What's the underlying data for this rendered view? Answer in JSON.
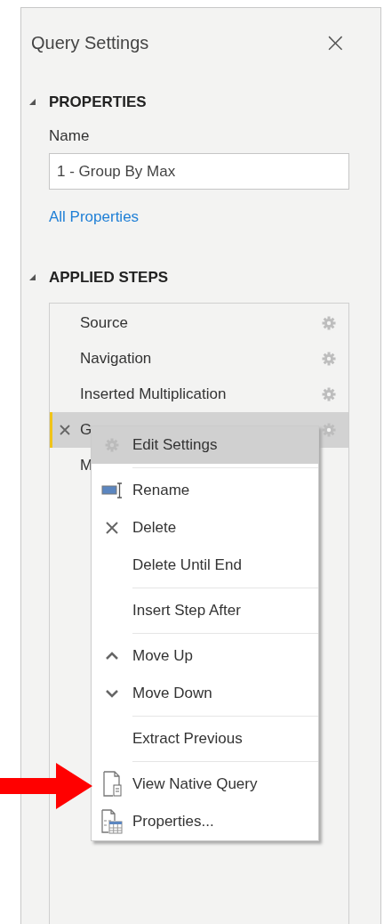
{
  "panel": {
    "title": "Query Settings",
    "close": "×"
  },
  "properties": {
    "heading": "PROPERTIES",
    "name_label": "Name",
    "name_value": "1 - Group By Max",
    "link": "All Properties"
  },
  "applied_steps": {
    "heading": "APPLIED STEPS",
    "steps": [
      {
        "name": "Source",
        "selected": false,
        "settings": true
      },
      {
        "name": "Navigation",
        "selected": false,
        "settings": true
      },
      {
        "name": "Inserted Multiplication",
        "selected": false,
        "settings": true
      },
      {
        "name": "G",
        "selected": true,
        "settings": true
      },
      {
        "name": "M",
        "selected": false,
        "settings": false
      }
    ]
  },
  "context_menu": {
    "groups": [
      [
        {
          "label": "Edit Settings",
          "kind": "settings",
          "selected": true
        }
      ],
      [
        {
          "label": "Rename",
          "kind": "rename",
          "selected": false
        },
        {
          "label": "Delete",
          "kind": "delete",
          "selected": false
        },
        {
          "label": "Delete Until End",
          "kind": "plain",
          "selected": false
        }
      ],
      [
        {
          "label": "Insert Step After",
          "kind": "plain",
          "selected": false
        }
      ],
      [
        {
          "label": "Move Up",
          "kind": "up",
          "selected": false
        },
        {
          "label": "Move Down",
          "kind": "down",
          "selected": false
        }
      ],
      [
        {
          "label": "Extract Previous",
          "kind": "plain",
          "selected": false
        }
      ],
      [
        {
          "label": "View Native Query",
          "kind": "native-query",
          "selected": false
        },
        {
          "label": "Properties...",
          "kind": "properties",
          "selected": false
        }
      ]
    ]
  }
}
